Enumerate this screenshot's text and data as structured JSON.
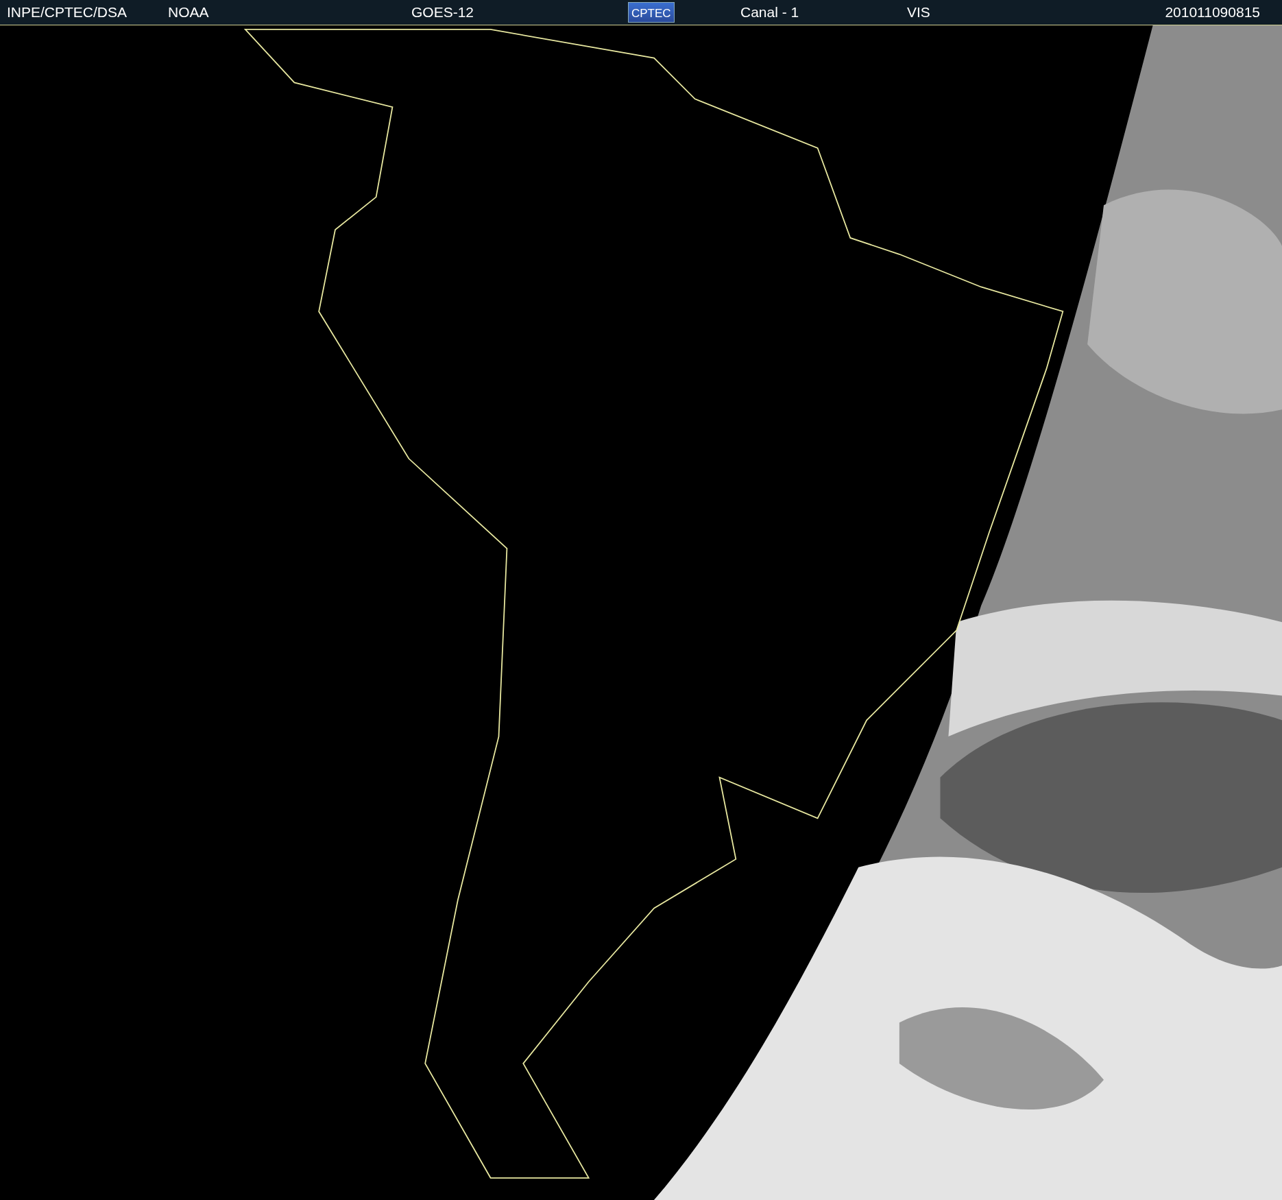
{
  "header": {
    "items": [
      {
        "kind": "text",
        "text": "INPE/CPTEC/DSA"
      },
      {
        "kind": "text",
        "text": "NOAA"
      },
      {
        "kind": "text",
        "text": "GOES-12"
      },
      {
        "kind": "logo",
        "text": "CPTEC"
      },
      {
        "kind": "text",
        "text": "Canal - 1"
      },
      {
        "kind": "text",
        "text": "VIS"
      },
      {
        "kind": "text",
        "text": "201011090815"
      }
    ]
  }
}
